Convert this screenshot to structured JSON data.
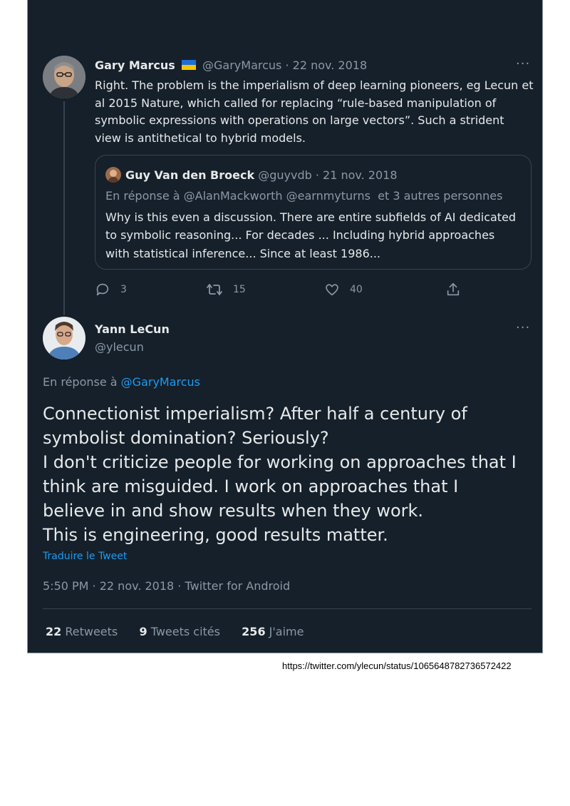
{
  "tweet1": {
    "author": "Gary Marcus",
    "flag_icon": "ukraine-flag-icon",
    "handle_date": "@GaryMarcus · 22 nov. 2018",
    "more": "···",
    "lines": [
      "Right. The problem is the imperialism of deep learning pioneers, eg Lecun et",
      "al 2015 Nature, which called for replacing “rule-based manipulation of",
      "symbolic expressions with operations on large vectors”. Such a strident",
      "view is antithetical to hybrid models."
    ],
    "quote": {
      "author": "Guy Van den Broeck",
      "handle_date": "@guyvdb · 21 nov. 2018",
      "reply_prefix": "En réponse à ",
      "reply_mentions": "@AlanMackworth @earnmyturns",
      "reply_suffix": "  et 3 autres personnes",
      "lines": [
        "Why is this even a discussion. There are entire subfields of AI dedicated",
        "to symbolic reasoning... For decades ... Including hybrid approaches",
        "with statistical inference... Since at least 1986..."
      ]
    },
    "actions": {
      "replies": "3",
      "retweets": "15",
      "likes": "40"
    }
  },
  "tweet2": {
    "author": "Yann LeCun",
    "handle": "@ylecun",
    "more": "···",
    "reply_prefix": "En réponse à ",
    "reply_mention": "@GaryMarcus",
    "lines": [
      "Connectionist imperialism? After half a century of",
      "symbolist domination? Seriously?",
      "I don't criticize people for working on approaches that I",
      "think are misguided. I work on approaches that I",
      "believe in and show results when they work.",
      "This is engineering, good results matter."
    ],
    "translate": "Traduire le Tweet",
    "meta": "5:50 PM · 22 nov. 2018 · Twitter for Android",
    "stats": {
      "retweets_num": "22",
      "retweets_label": "Retweets",
      "quotes_num": "9",
      "quotes_label": "Tweets cités",
      "likes_num": "256",
      "likes_label": "J'aime"
    }
  },
  "source_url": "https://twitter.com/ylecun/status/1065648782736572422"
}
